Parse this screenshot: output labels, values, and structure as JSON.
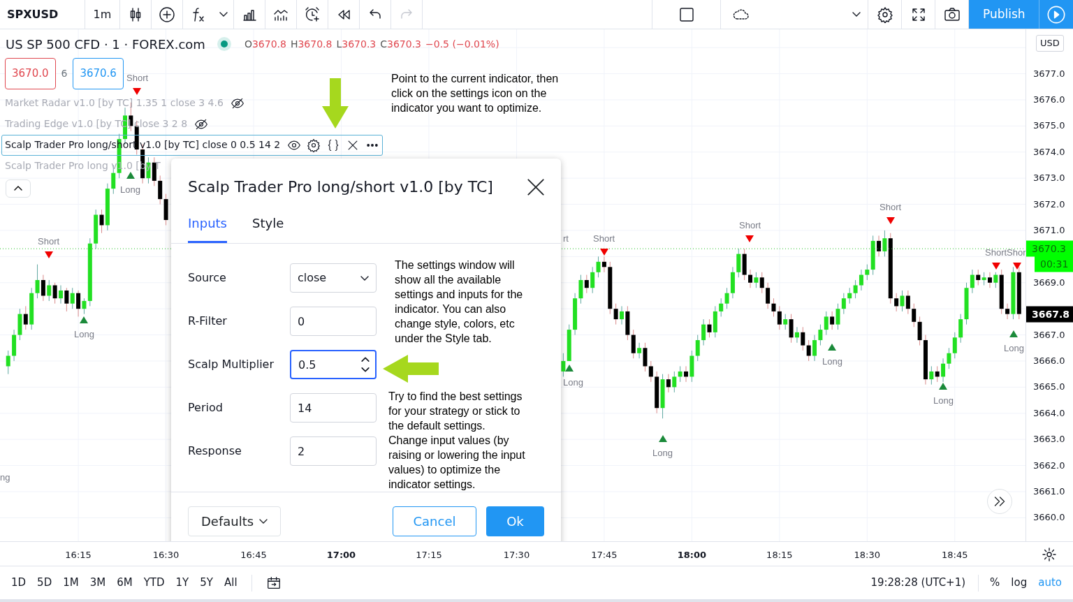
{
  "toolbar": {
    "symbol": "SPXUSD",
    "interval": "1m",
    "redo_disabled": true,
    "publish": "Publish"
  },
  "legend": {
    "title": "US SP 500 CFD · 1 · FOREX.com",
    "market_open": true,
    "ohlc": [
      {
        "key": "O",
        "value": "3670.8"
      },
      {
        "key": "H",
        "value": "3670.8"
      },
      {
        "key": "L",
        "value": "3670.3"
      },
      {
        "key": "C",
        "value": "3670.3"
      }
    ],
    "change": "−0.5 (−0.01%)",
    "sell": "3670.0",
    "spread": "6",
    "buy": "3670.6",
    "indicators": [
      {
        "name": "Market Radar v1.0 [by TC] 1.35 1 close 3 4.6",
        "dimmed": true,
        "hidden": true,
        "selected": false
      },
      {
        "name": "Trading Edge v1.0 [by TC] close 3 2 8",
        "dimmed": true,
        "hidden": true,
        "selected": false
      },
      {
        "name": "Scalp Trader Pro long/short v1.0 [by TC] close 0 0.5 14 2",
        "dimmed": false,
        "hidden": false,
        "selected": true
      },
      {
        "name": "Scalp Trader Pro long v1.0 [by T",
        "dimmed": true,
        "hidden": false,
        "selected": false
      }
    ]
  },
  "annotation": "Point to the current indicator, then click on the settings icon on the indicator you want to optimize.",
  "chart": {
    "chart_data": {
      "type": "candlestick",
      "categories": [
        null,
        null,
        null,
        null,
        null,
        null,
        null,
        null,
        null,
        null,
        null,
        null,
        "16:15",
        null,
        null,
        null,
        null,
        null,
        null,
        null,
        null,
        null,
        null,
        null,
        null,
        null,
        null,
        "16:30",
        null,
        null,
        null,
        null,
        null,
        null,
        null,
        null,
        null,
        null,
        null,
        null,
        null,
        null,
        "16:45",
        null,
        null,
        null,
        null,
        null,
        null,
        null,
        null,
        null,
        null,
        null,
        null,
        null,
        null,
        "17:00",
        null,
        null,
        null,
        null,
        null,
        null,
        null,
        null,
        null,
        null,
        null,
        null,
        null,
        null,
        "17:15",
        null,
        null,
        null,
        null,
        null,
        null,
        null,
        null,
        null,
        null,
        null,
        null,
        null,
        null,
        "17:30",
        null,
        null,
        null,
        null,
        null,
        null,
        null,
        null,
        null,
        null,
        null,
        null,
        null,
        null,
        "17:45",
        null,
        null,
        null,
        null,
        null,
        null,
        null,
        null,
        null,
        null,
        null,
        null,
        null,
        null,
        "18:00",
        null,
        null,
        null,
        null,
        null,
        null,
        null,
        null,
        null,
        null,
        null,
        null,
        null,
        null,
        "18:15",
        null,
        null,
        null,
        null,
        null,
        null,
        null,
        null,
        null,
        null,
        null,
        null,
        null,
        null,
        "18:30",
        null,
        null,
        null,
        null,
        null,
        null,
        null,
        null,
        null,
        null,
        null,
        null,
        null,
        null,
        "18:45",
        null,
        null,
        null,
        null,
        null,
        null,
        null,
        null,
        null,
        null,
        null
      ],
      "ohlc": [
        [
          3665.8,
          3666.4,
          3665.5,
          3666.2
        ],
        [
          3666.2,
          3667.2,
          3666.0,
          3667.0
        ],
        [
          3667.0,
          3668.0,
          3666.8,
          3667.8
        ],
        [
          3667.8,
          3668.1,
          3667.2,
          3667.4
        ],
        [
          3667.4,
          3668.8,
          3667.2,
          3668.6
        ],
        [
          3668.6,
          3669.7,
          3668.4,
          3669.1
        ],
        [
          3669.1,
          3669.3,
          3668.3,
          3668.5
        ],
        [
          3668.5,
          3669.1,
          3668.3,
          3668.9
        ],
        [
          3668.9,
          3669.0,
          3668.2,
          3668.4
        ],
        [
          3668.4,
          3668.9,
          3668.2,
          3668.7
        ],
        [
          3668.7,
          3668.8,
          3667.9,
          3668.2
        ],
        [
          3668.2,
          3668.8,
          3668.0,
          3668.6
        ],
        [
          3668.6,
          3668.7,
          3667.7,
          3668.0
        ],
        [
          3668.0,
          3668.4,
          3667.8,
          3668.3
        ],
        [
          3668.3,
          3670.7,
          3668.1,
          3670.5
        ],
        [
          3670.5,
          3671.8,
          3670.3,
          3671.6
        ],
        [
          3671.6,
          3671.8,
          3670.9,
          3671.2
        ],
        [
          3671.2,
          3672.8,
          3671.0,
          3672.6
        ],
        [
          3672.6,
          3673.5,
          3672.4,
          3673.2
        ],
        [
          3673.2,
          3674.7,
          3673.0,
          3674.5
        ],
        [
          3674.5,
          3675.7,
          3674.3,
          3675.4
        ],
        [
          3675.4,
          3675.9,
          3674.8,
          3675.0
        ],
        [
          3675.0,
          3675.2,
          3673.9,
          3674.1
        ],
        [
          3674.1,
          3674.3,
          3672.8,
          3673.0
        ],
        [
          3673.0,
          3673.8,
          3672.8,
          3673.6
        ],
        [
          3673.6,
          3673.8,
          3672.7,
          3672.9
        ],
        [
          3672.9,
          3673.1,
          3672.0,
          3672.2
        ],
        [
          3672.2,
          3672.4,
          3671.2,
          3671.4
        ],
        null,
        null,
        null,
        null,
        null,
        null,
        null,
        null,
        null,
        null,
        null,
        null,
        null,
        null,
        null,
        null,
        null,
        null,
        null,
        null,
        null,
        null,
        null,
        null,
        null,
        null,
        null,
        null,
        null,
        null,
        null,
        null,
        null,
        null,
        null,
        null,
        null,
        null,
        null,
        null,
        null,
        null,
        null,
        null,
        null,
        null,
        null,
        null,
        null,
        null,
        null,
        null,
        null,
        null,
        null,
        null,
        null,
        null,
        null,
        null,
        null,
        null,
        null,
        null,
        null,
        null,
        null,
        [
          3665.6,
          3666.3,
          3665.4,
          3666.0
        ],
        [
          3666.0,
          3667.4,
          3666.0,
          3667.2
        ],
        [
          3667.2,
          3668.6,
          3667.0,
          3668.4
        ],
        [
          3668.4,
          3669.3,
          3668.2,
          3669.1
        ],
        [
          3669.1,
          3669.3,
          3668.6,
          3668.8
        ],
        [
          3668.8,
          3669.6,
          3668.6,
          3669.4
        ],
        [
          3669.4,
          3670.0,
          3669.2,
          3669.8
        ],
        [
          3669.8,
          3670.0,
          3669.4,
          3669.6
        ],
        [
          3669.6,
          3669.8,
          3667.8,
          3668.0
        ],
        [
          3668.0,
          3668.2,
          3667.4,
          3667.6
        ],
        [
          3667.6,
          3668.1,
          3667.4,
          3667.9
        ],
        [
          3667.9,
          3668.1,
          3666.8,
          3667.0
        ],
        [
          3667.0,
          3667.2,
          3666.1,
          3666.3
        ],
        [
          3666.3,
          3666.7,
          3666.1,
          3666.5
        ],
        [
          3666.5,
          3666.7,
          3665.6,
          3665.8
        ],
        [
          3665.8,
          3666.0,
          3665.2,
          3665.4
        ],
        [
          3665.4,
          3665.6,
          3664.0,
          3664.2
        ],
        [
          3664.2,
          3665.5,
          3663.8,
          3665.3
        ],
        [
          3665.3,
          3665.5,
          3664.8,
          3665.0
        ],
        [
          3665.0,
          3665.6,
          3664.8,
          3665.4
        ],
        [
          3665.4,
          3665.8,
          3665.2,
          3665.6
        ],
        [
          3665.6,
          3665.8,
          3665.2,
          3665.4
        ],
        [
          3665.4,
          3666.4,
          3665.2,
          3666.2
        ],
        [
          3666.2,
          3667.0,
          3666.0,
          3666.8
        ],
        [
          3666.8,
          3667.6,
          3666.6,
          3667.4
        ],
        [
          3667.4,
          3667.6,
          3666.9,
          3667.1
        ],
        [
          3667.1,
          3668.1,
          3666.9,
          3667.9
        ],
        [
          3667.9,
          3668.4,
          3667.7,
          3668.2
        ],
        [
          3668.2,
          3668.8,
          3668.0,
          3668.6
        ],
        [
          3668.6,
          3669.6,
          3668.4,
          3669.4
        ],
        [
          3669.4,
          3670.3,
          3669.2,
          3670.1
        ],
        [
          3670.1,
          3670.3,
          3669.1,
          3669.3
        ],
        [
          3669.3,
          3669.5,
          3668.8,
          3669.0
        ],
        [
          3669.0,
          3669.4,
          3668.8,
          3669.2
        ],
        [
          3669.2,
          3669.4,
          3668.6,
          3668.8
        ],
        [
          3668.8,
          3669.0,
          3668.0,
          3668.2
        ],
        [
          3668.2,
          3668.4,
          3667.7,
          3667.9
        ],
        [
          3667.9,
          3668.1,
          3667.2,
          3667.4
        ],
        [
          3667.4,
          3667.8,
          3667.2,
          3667.6
        ],
        [
          3667.6,
          3667.8,
          3666.7,
          3666.9
        ],
        [
          3666.9,
          3667.3,
          3666.7,
          3667.1
        ],
        [
          3667.1,
          3667.3,
          3666.4,
          3666.6
        ],
        [
          3666.6,
          3666.8,
          3666.0,
          3666.2
        ],
        [
          3666.2,
          3667.0,
          3666.0,
          3666.8
        ],
        [
          3666.8,
          3667.4,
          3666.6,
          3667.2
        ],
        [
          3667.2,
          3667.9,
          3667.0,
          3667.7
        ],
        [
          3667.7,
          3667.9,
          3667.2,
          3667.4
        ],
        [
          3667.4,
          3668.2,
          3667.2,
          3668.0
        ],
        [
          3668.0,
          3668.6,
          3667.8,
          3668.4
        ],
        [
          3668.4,
          3668.8,
          3668.2,
          3668.6
        ],
        [
          3668.6,
          3669.1,
          3668.4,
          3668.9
        ],
        [
          3668.9,
          3669.5,
          3668.7,
          3669.3
        ],
        [
          3669.3,
          3669.7,
          3669.1,
          3669.5
        ],
        [
          3669.5,
          3670.8,
          3669.3,
          3670.6
        ],
        [
          3670.6,
          3670.8,
          3670.0,
          3670.2
        ],
        [
          3670.2,
          3671.0,
          3670.0,
          3670.7
        ],
        [
          3670.7,
          3670.9,
          3668.2,
          3668.4
        ],
        [
          3668.4,
          3668.6,
          3667.9,
          3668.1
        ],
        [
          3668.1,
          3668.7,
          3667.9,
          3668.5
        ],
        [
          3668.5,
          3668.7,
          3667.8,
          3668.0
        ],
        [
          3668.0,
          3668.2,
          3667.3,
          3667.5
        ],
        [
          3667.5,
          3667.7,
          3666.6,
          3666.8
        ],
        [
          3666.8,
          3667.0,
          3665.1,
          3665.3
        ],
        [
          3665.3,
          3665.8,
          3665.1,
          3665.6
        ],
        [
          3665.6,
          3665.8,
          3665.2,
          3665.4
        ],
        [
          3665.4,
          3666.1,
          3665.2,
          3665.9
        ],
        [
          3665.9,
          3666.5,
          3665.7,
          3666.3
        ],
        [
          3666.3,
          3667.1,
          3666.1,
          3666.9
        ],
        [
          3666.9,
          3667.8,
          3666.7,
          3667.6
        ],
        [
          3667.6,
          3669.0,
          3667.4,
          3668.8
        ],
        [
          3668.8,
          3669.5,
          3668.6,
          3669.3
        ],
        [
          3669.3,
          3669.5,
          3668.9,
          3669.1
        ],
        [
          3669.1,
          3669.4,
          3668.9,
          3669.2
        ],
        [
          3669.2,
          3669.4,
          3668.8,
          3669.0
        ],
        [
          3669.0,
          3669.4,
          3668.8,
          3669.3
        ],
        [
          3669.3,
          3669.5,
          3667.8,
          3668.0
        ],
        [
          3668.0,
          3668.2,
          3667.6,
          3667.8
        ],
        [
          3667.8,
          3669.6,
          3667.6,
          3669.4
        ],
        [
          3669.4,
          3669.6,
          3667.6,
          3667.8
        ]
      ],
      "ylim": [
        3659.1,
        3678.7
      ],
      "grid": true,
      "ref_lines": [
        {
          "axis": "y",
          "value": 3670.3,
          "color": "#22c022"
        }
      ],
      "yticks": [
        {
          "value": 3677,
          "label": "3677.0"
        },
        {
          "value": 3676,
          "label": "3676.0"
        },
        {
          "value": 3675,
          "label": "3675.0"
        },
        {
          "value": 3674,
          "label": "3674.0"
        },
        {
          "value": 3673,
          "label": "3673.0"
        },
        {
          "value": 3672,
          "label": "3672.0"
        },
        {
          "value": 3671,
          "label": "3671.0"
        },
        {
          "value": 3669,
          "label": "3669.0"
        },
        {
          "value": 3667,
          "label": "3667.0"
        },
        {
          "value": 3666,
          "label": "3666.0"
        },
        {
          "value": 3665,
          "label": "3665.0"
        },
        {
          "value": 3664,
          "label": "3664.0"
        },
        {
          "value": 3663,
          "label": "3663.0"
        },
        {
          "value": 3662,
          "label": "3662.0"
        },
        {
          "value": 3661,
          "label": "3661.0"
        },
        {
          "value": 3660,
          "label": "3660.0"
        }
      ]
    },
    "major_time_labels": [
      false,
      false,
      false,
      true,
      false,
      false,
      false,
      true,
      false,
      false,
      false
    ],
    "signals": [
      {
        "kind": "short",
        "label": "Short",
        "marker": true
      },
      {
        "kind": "long",
        "label": "Long",
        "marker": true
      },
      {
        "kind": "short",
        "label": "Short",
        "marker": true
      },
      {
        "kind": "long",
        "label": "Long",
        "marker": true
      },
      {
        "kind": "short",
        "label": "rt",
        "marker": false
      },
      {
        "kind": "short",
        "label": "Short",
        "marker": true
      },
      {
        "kind": "short",
        "label": "Short",
        "marker": true
      },
      {
        "kind": "short",
        "label": "Short",
        "marker": true
      },
      {
        "kind": "short",
        "label": "Short",
        "marker": true
      },
      {
        "kind": "short",
        "label": "Shor",
        "marker": true
      },
      {
        "kind": "long",
        "label": "Long",
        "marker": true
      },
      {
        "kind": "long",
        "label": "Long",
        "marker": true
      },
      {
        "kind": "long",
        "label": "Long",
        "marker": true
      },
      {
        "kind": "long",
        "label": "Long",
        "marker": true
      },
      {
        "kind": "long",
        "label": "Long",
        "marker": true
      },
      {
        "kind": "long",
        "label": "ng",
        "marker": false
      }
    ],
    "currency": "USD",
    "last_price": "3670.3",
    "countdown": "00:31",
    "crosshair_price": "3667.8"
  },
  "dialog": {
    "title": "Scalp Trader Pro long/short v1.0 [by TC]",
    "tabs": [
      {
        "label": "Inputs",
        "selected": true
      },
      {
        "label": "Style",
        "selected": false
      }
    ],
    "inputs": [
      {
        "label": "Source",
        "kind": "select",
        "value": "close",
        "focused": false
      },
      {
        "label": "R-Filter",
        "kind": "text",
        "value": "0",
        "focused": false
      },
      {
        "label": "Scalp Multiplier",
        "kind": "number",
        "value": "0.5",
        "focused": true
      },
      {
        "label": "Period",
        "kind": "text",
        "value": "14",
        "focused": false
      },
      {
        "label": "Response",
        "kind": "text",
        "value": "2",
        "focused": false
      }
    ],
    "help": [
      "The settings window will show all the available settings and inputs for the indicator. You can also change style, colors, etc under the Style tab.",
      "Try to find the best settings for your strategy or stick to the default settings.\nChange input values (by raising or lowering the input values) to optimize the indicator settings."
    ],
    "defaults": "Defaults",
    "cancel": "Cancel",
    "ok": "Ok"
  },
  "bottom": {
    "ranges": [
      "1D",
      "5D",
      "1M",
      "3M",
      "6M",
      "YTD",
      "1Y",
      "5Y",
      "All"
    ],
    "clock": "19:28:28 (UTC+1)",
    "scale_options": [
      {
        "label": "%",
        "selected": false
      },
      {
        "label": "log",
        "selected": false
      },
      {
        "label": "auto",
        "selected": true
      }
    ]
  }
}
